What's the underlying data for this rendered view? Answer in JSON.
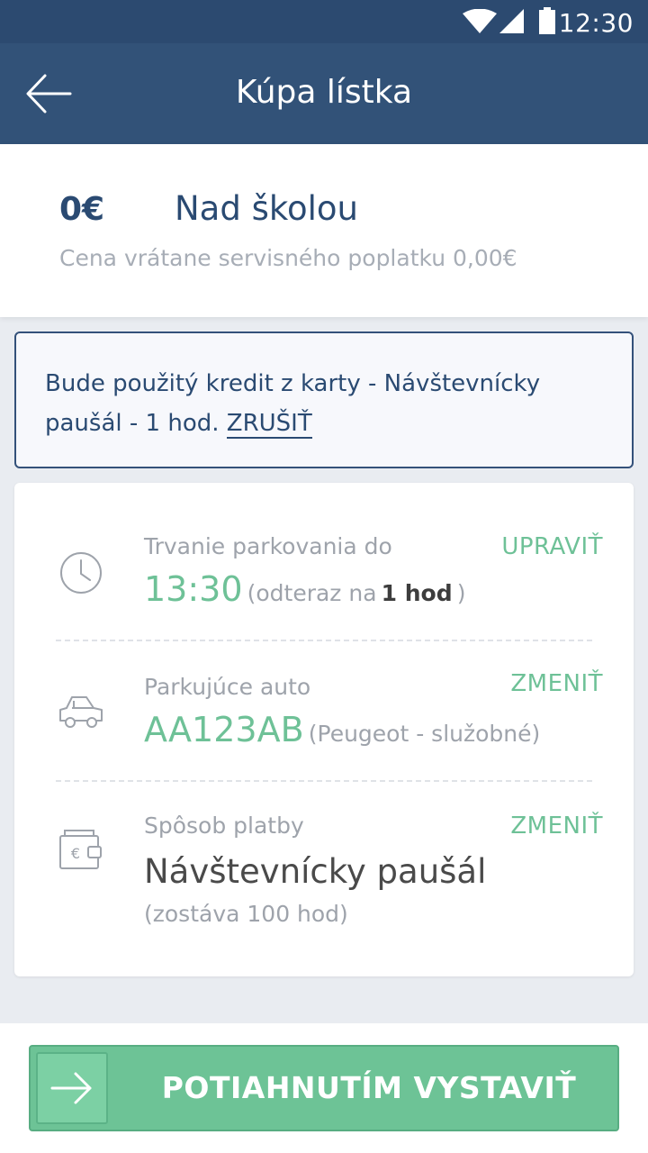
{
  "status_bar": {
    "time": "12:30"
  },
  "app_bar": {
    "title": "Kúpa lístka"
  },
  "summary": {
    "price": "0€",
    "zone": "Nad školou",
    "fee_text": "Cena vrátane servisného poplatku 0,00€"
  },
  "notice": {
    "text": "Bude použitý kredit z karty - Návštevnícky paušál - 1 hod.",
    "cancel_label": "ZRUŠIŤ"
  },
  "details": {
    "duration": {
      "label": "Trvanie parkovania do",
      "action": "UPRAVIŤ",
      "time": "13:30",
      "note_prefix": "(odteraz na",
      "note_value": "1 hod",
      "note_suffix": ")"
    },
    "car": {
      "label": "Parkujúce auto",
      "action": "ZMENIŤ",
      "plate": "AA123AB",
      "description": "(Peugeot - služobné)"
    },
    "payment": {
      "label": "Spôsob platby",
      "action": "ZMENIŤ",
      "method": "Návštevnícky paušál",
      "remaining": "(zostáva 100 hod)"
    }
  },
  "slide_action": {
    "label": "POTIAHNUTÍM VYSTAVIŤ"
  },
  "colors": {
    "primary": "#325278",
    "status_bar": "#2c4a70",
    "accent_green": "#6ec197",
    "text_dark_blue": "#2a4a72",
    "text_grey": "#9ea3ab"
  },
  "icons": {
    "back": "arrow-left-icon",
    "duration": "clock-icon",
    "car": "car-icon",
    "payment": "wallet-euro-icon",
    "slide": "arrow-right-icon"
  }
}
